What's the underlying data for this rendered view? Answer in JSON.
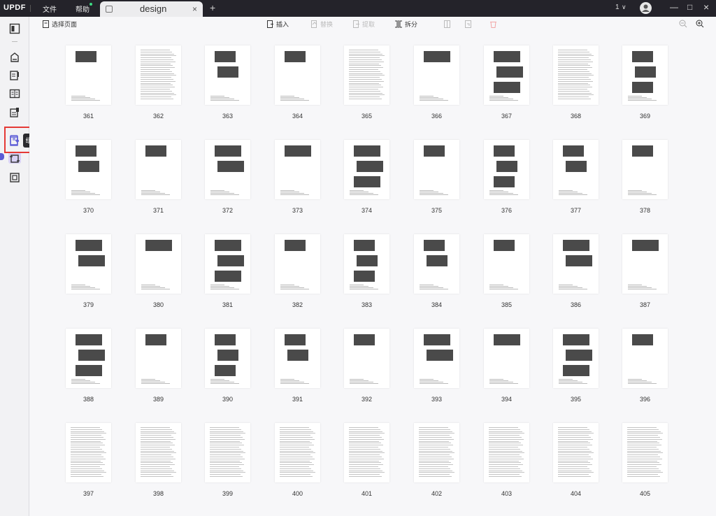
{
  "app": {
    "logo": "UPDF",
    "menu": [
      {
        "label": "文件"
      },
      {
        "label": "帮助"
      }
    ],
    "tab": {
      "title": "design",
      "close": "×"
    },
    "tab_add": "+",
    "page_indicator": "1",
    "window_controls": [
      "—",
      "□",
      "×"
    ]
  },
  "toolbar": {
    "select_pages": "选择页面",
    "insert": "插入",
    "replace": "替换",
    "extract": "提取",
    "split": "拆分"
  },
  "sidebar": {
    "tooltip": "组织页面",
    "icons": [
      "reader-icon",
      "comment-icon",
      "edit-icon",
      "form-icon",
      "ocr-icon",
      "organize-pages-icon",
      "crop-icon",
      "protect-icon"
    ]
  },
  "colors": {
    "accent": "#5b5bd6",
    "highlight": "#e53935",
    "titlebar": "#24232a"
  },
  "pages": [
    {
      "num": "361"
    },
    {
      "num": "362"
    },
    {
      "num": "363"
    },
    {
      "num": "364"
    },
    {
      "num": "365"
    },
    {
      "num": "366"
    },
    {
      "num": "367"
    },
    {
      "num": "368"
    },
    {
      "num": "369"
    },
    {
      "num": "370"
    },
    {
      "num": "371"
    },
    {
      "num": "372"
    },
    {
      "num": "373"
    },
    {
      "num": "374"
    },
    {
      "num": "375"
    },
    {
      "num": "376"
    },
    {
      "num": "377"
    },
    {
      "num": "378"
    },
    {
      "num": "379"
    },
    {
      "num": "380"
    },
    {
      "num": "381"
    },
    {
      "num": "382"
    },
    {
      "num": "383"
    },
    {
      "num": "384"
    },
    {
      "num": "385"
    },
    {
      "num": "386"
    },
    {
      "num": "387"
    },
    {
      "num": "388"
    },
    {
      "num": "389"
    },
    {
      "num": "390"
    },
    {
      "num": "391"
    },
    {
      "num": "392"
    },
    {
      "num": "393"
    },
    {
      "num": "394"
    },
    {
      "num": "395"
    },
    {
      "num": "396"
    },
    {
      "num": "397"
    },
    {
      "num": "398"
    },
    {
      "num": "399"
    },
    {
      "num": "400"
    },
    {
      "num": "401"
    },
    {
      "num": "402"
    },
    {
      "num": "403"
    },
    {
      "num": "404"
    },
    {
      "num": "405"
    }
  ]
}
